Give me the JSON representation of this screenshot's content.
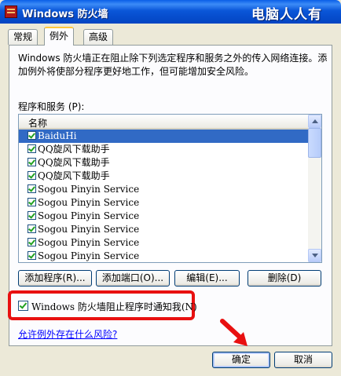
{
  "window": {
    "title": "Windows 防火墙",
    "watermark": "电脑人人有"
  },
  "tabs": [
    {
      "label": "常规",
      "active": false
    },
    {
      "label": "例外",
      "active": true
    },
    {
      "label": "高级",
      "active": false
    }
  ],
  "description": "Windows 防火墙正在阻止除下列选定程序和服务之外的传入网络连接。添加例外将使部分程序更好地工作，但可能增加安全风险。",
  "list": {
    "label": "程序和服务 (P):",
    "column_header": "名称",
    "items": [
      {
        "label": "BaiduHi",
        "checked": true,
        "selected": true
      },
      {
        "label": "QQ旋风下载助手",
        "checked": true,
        "selected": false
      },
      {
        "label": "QQ旋风下载助手",
        "checked": true,
        "selected": false
      },
      {
        "label": "QQ旋风下载助手",
        "checked": true,
        "selected": false
      },
      {
        "label": "Sogou Pinyin Service",
        "checked": true,
        "selected": false
      },
      {
        "label": "Sogou Pinyin Service",
        "checked": true,
        "selected": false
      },
      {
        "label": "Sogou Pinyin Service",
        "checked": true,
        "selected": false
      },
      {
        "label": "Sogou Pinyin Service",
        "checked": true,
        "selected": false
      },
      {
        "label": "Sogou Pinyin Service",
        "checked": true,
        "selected": false
      },
      {
        "label": "Sogou Pinyin Service",
        "checked": true,
        "selected": false
      }
    ]
  },
  "buttons": {
    "add_program": "添加程序(R)...",
    "add_port": "添加端口(O)...",
    "edit": "编辑(E)...",
    "delete": "删除(D)",
    "ok": "确定",
    "cancel": "取消"
  },
  "notify_checkbox": {
    "label": "Windows 防火墙阻止程序时通知我(N)",
    "checked": true
  },
  "risk_link": "允许例外存在什么风险?",
  "colors": {
    "highlight": "#E81010",
    "selection": "#316AC5",
    "titlebar": "#0A56D8"
  }
}
